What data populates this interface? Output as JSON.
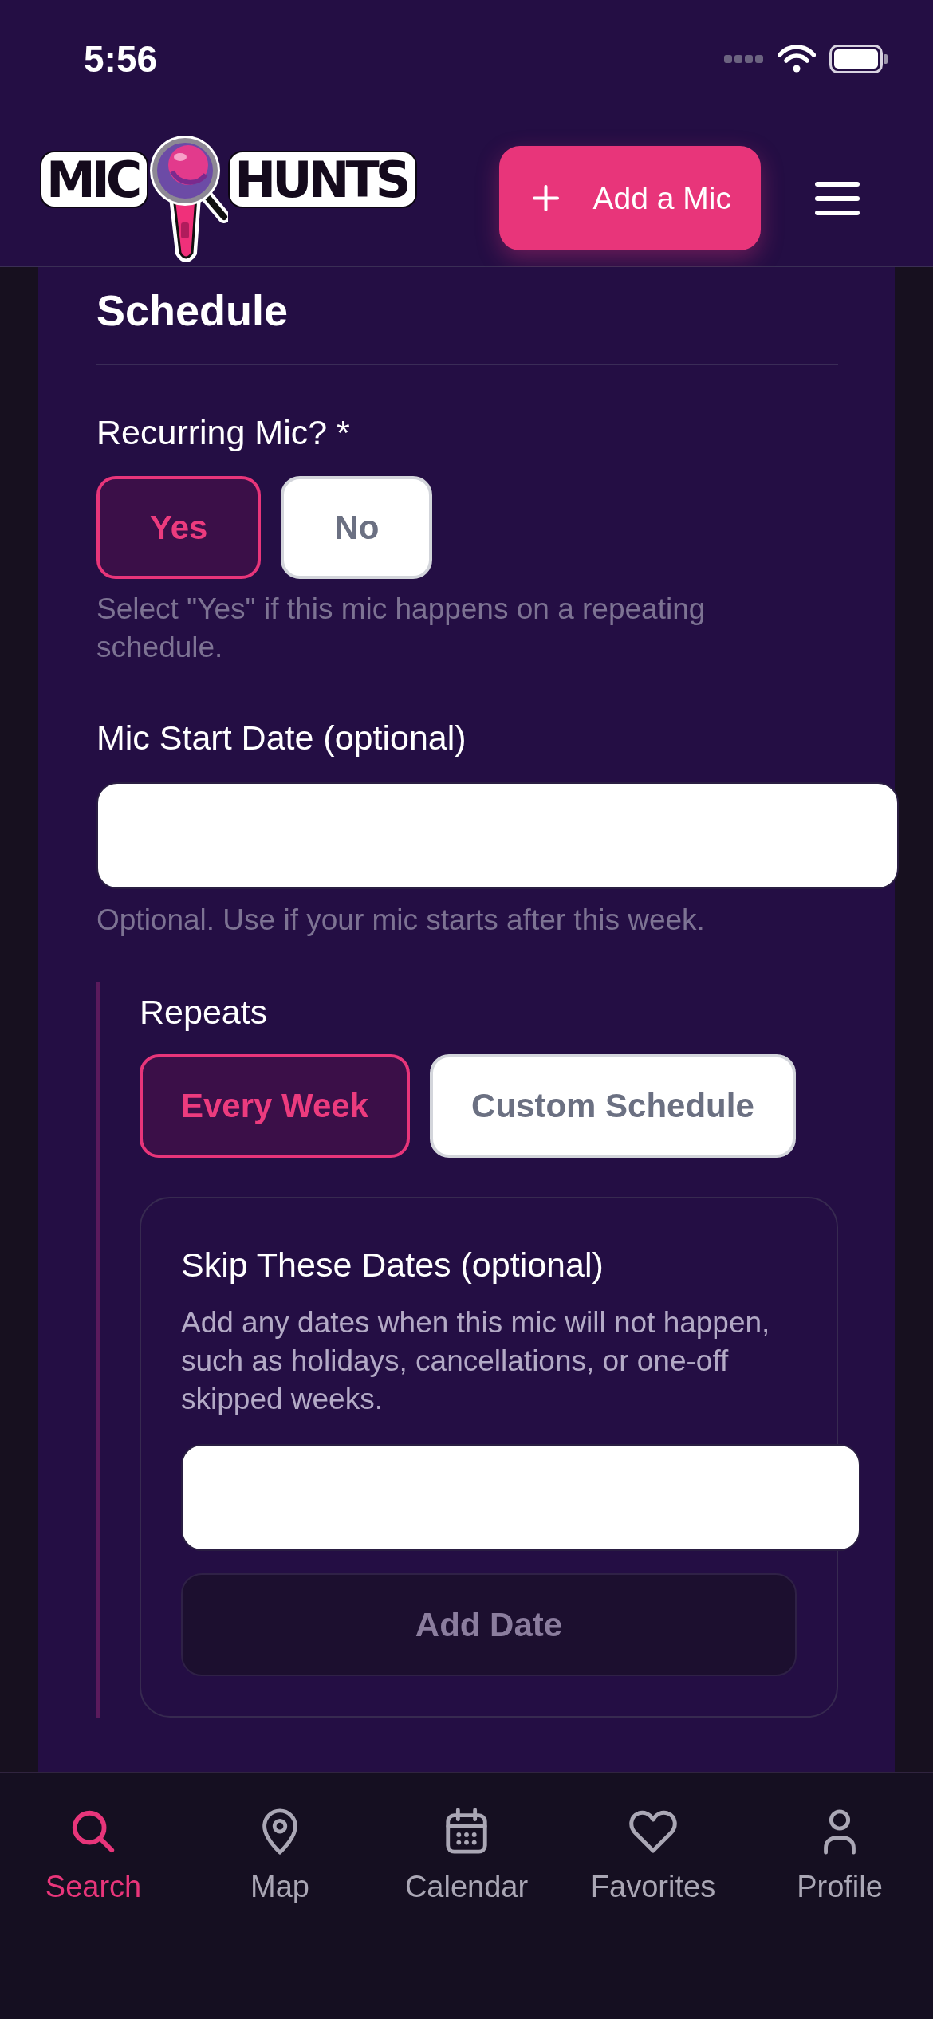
{
  "status_bar": {
    "time": "5:56"
  },
  "header": {
    "logo": {
      "word_1": "MIC",
      "word_2": "HUNTS"
    },
    "add_button": {
      "label": "Add a Mic"
    }
  },
  "form": {
    "title": "Schedule",
    "recurring": {
      "label": "Recurring Mic? *",
      "options": [
        {
          "label": "Yes",
          "selected": true
        },
        {
          "label": "No",
          "selected": false
        }
      ],
      "help": "Select \"Yes\" if this mic happens on a repeating schedule."
    },
    "start_date": {
      "label": "Mic Start Date (optional)",
      "help": "Optional. Use if your mic starts after this week."
    },
    "repeats": {
      "label": "Repeats",
      "options": [
        {
          "label": "Every Week",
          "selected": true
        },
        {
          "label": "Custom Schedule",
          "selected": false
        }
      ],
      "skip_dates": {
        "title": "Skip These Dates (optional)",
        "description": "Add any dates when this mic will not happen, such as holidays, cancellations, or one-off skipped weeks.",
        "add_button": {
          "label": "Add Date",
          "disabled": true
        }
      }
    }
  },
  "bottom_nav": {
    "items": [
      {
        "label": "Search",
        "selected": true
      },
      {
        "label": "Map",
        "selected": false
      },
      {
        "label": "Calendar",
        "selected": false
      },
      {
        "label": "Favorites",
        "selected": false
      },
      {
        "label": "Profile",
        "selected": false
      }
    ]
  }
}
